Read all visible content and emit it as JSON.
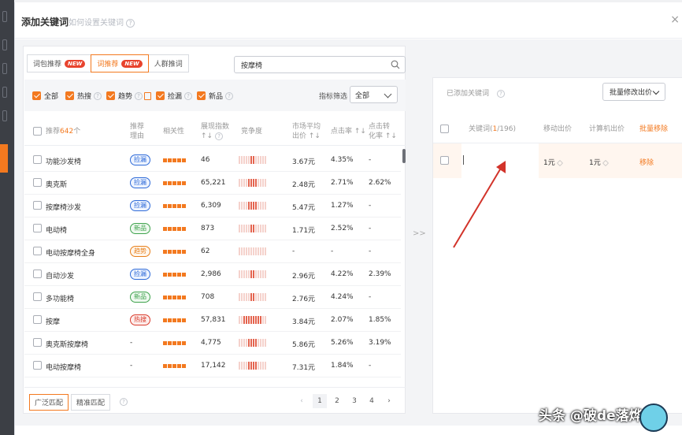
{
  "modal": {
    "title": "添加关键词",
    "help_text": "如何设置关键词",
    "close_glyph": "×"
  },
  "tabs": [
    {
      "label": "词包推荐",
      "badge": "NEW",
      "active": false
    },
    {
      "label": "词推荐",
      "badge": "NEW",
      "active": true
    },
    {
      "label": "人群推词",
      "badge": "",
      "active": false
    }
  ],
  "search": {
    "value": "按摩椅"
  },
  "filters": [
    {
      "label": "全部",
      "checked": true
    },
    {
      "label": "热搜",
      "checked": true
    },
    {
      "label": "趋势",
      "checked": true
    },
    {
      "label": "捡漏",
      "checked": true
    },
    {
      "label": "新品",
      "checked": true
    }
  ],
  "indicator_filter": {
    "label": "指标筛选",
    "value": "全部"
  },
  "table_header": {
    "recommend_prefix": "推荐",
    "recommend_count": "642",
    "recommend_suffix": "个",
    "reason_l1": "推荐",
    "reason_l2": "理由",
    "relevance": "相关性",
    "impressions_l1": "展现指数",
    "impressions_l2": "↑↓",
    "competition": "竞争度",
    "bid_l1": "市场平均",
    "bid_l2": "出价 ↑↓",
    "ctr": "点击率 ↑↓",
    "cvr_l1": "点击转",
    "cvr_l2": "化率 ↑↓"
  },
  "rows": [
    {
      "keyword": "功能沙发椅",
      "tag": "捡漏",
      "tag_color": "blue",
      "impressions": "46",
      "competition": 1,
      "bid": "3.67元",
      "ctr": "4.35%",
      "cvr": "-"
    },
    {
      "keyword": "奥克斯",
      "tag": "捡漏",
      "tag_color": "blue",
      "impressions": "65,221",
      "competition": 4,
      "bid": "2.48元",
      "ctr": "2.71%",
      "cvr": "2.62%"
    },
    {
      "keyword": "按摩椅沙发",
      "tag": "捡漏",
      "tag_color": "blue",
      "impressions": "6,309",
      "competition": 4,
      "bid": "5.47元",
      "ctr": "1.27%",
      "cvr": "-"
    },
    {
      "keyword": "电动椅",
      "tag": "新品",
      "tag_color": "green",
      "impressions": "873",
      "competition": 2,
      "bid": "1.71元",
      "ctr": "2.52%",
      "cvr": "-"
    },
    {
      "keyword": "电动按摩椅全身",
      "tag": "趋势",
      "tag_color": "orange",
      "impressions": "62",
      "competition": 0,
      "bid": "-",
      "ctr": "-",
      "cvr": "-"
    },
    {
      "keyword": "自动沙发",
      "tag": "捡漏",
      "tag_color": "blue",
      "impressions": "2,986",
      "competition": 2,
      "bid": "2.96元",
      "ctr": "4.22%",
      "cvr": "2.39%"
    },
    {
      "keyword": "多功能椅",
      "tag": "新品",
      "tag_color": "green",
      "impressions": "708",
      "competition": 2,
      "bid": "2.76元",
      "ctr": "4.24%",
      "cvr": "-"
    },
    {
      "keyword": "按摩",
      "tag": "热搜",
      "tag_color": "red",
      "impressions": "57,831",
      "competition": 7,
      "bid": "3.84元",
      "ctr": "2.07%",
      "cvr": "1.85%"
    },
    {
      "keyword": "奥克斯按摩椅",
      "tag": "-",
      "tag_color": "",
      "impressions": "4,775",
      "competition": 3,
      "bid": "5.86元",
      "ctr": "5.26%",
      "cvr": "3.19%"
    },
    {
      "keyword": "电动按摩椅",
      "tag": "-",
      "tag_color": "",
      "impressions": "17,142",
      "competition": 3,
      "bid": "7.31元",
      "ctr": "1.84%",
      "cvr": "-"
    }
  ],
  "footer": {
    "broad_match": "广泛匹配",
    "exact_match": "精准匹配",
    "pages": [
      "1",
      "2",
      "3",
      "4"
    ],
    "prev": "‹",
    "next": "›"
  },
  "transfer_arrows": ">>",
  "right": {
    "title": "已添加关键词",
    "batch_button": "批量修改出价",
    "col_keyword_prefix": "关键词(",
    "col_keyword_count": "1",
    "col_keyword_suffix": "/196)",
    "col_mobile_bid": "移动出价",
    "col_pc_bid": "计算机出价",
    "col_batch_remove": "批量移除",
    "row": {
      "keyword": "",
      "mobile_bid": "1元",
      "pc_bid": "1元",
      "remove": "移除"
    }
  },
  "watermark": "头条 @破de落烨",
  "colors": {
    "accent": "#f3791f",
    "arrow": "#d2332a"
  }
}
